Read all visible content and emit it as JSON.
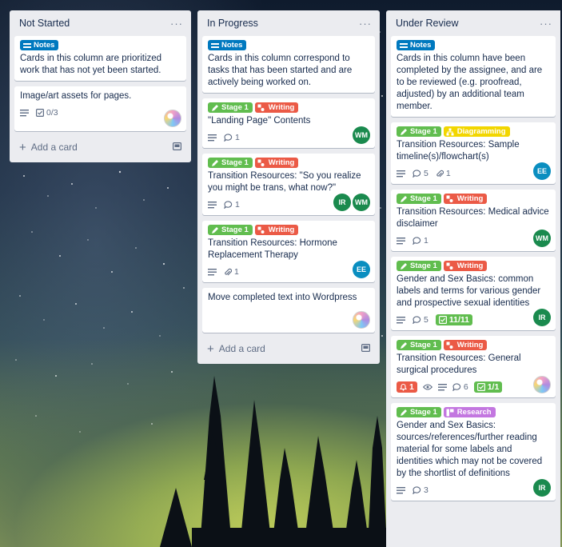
{
  "colors": {
    "notes": "#0079bf",
    "stage": "#61bd4f",
    "writing": "#eb5a46",
    "diagramming": "#f2d600",
    "research": "#c377e0",
    "avatar_wm": "#1a8a4e",
    "avatar_ir": "#1a8a4e",
    "avatar_ee": "#0a8ec0"
  },
  "columns": {
    "not_started": {
      "title": "Not Started",
      "menu": "···",
      "add_card": "Add a card",
      "cards": {
        "notes": {
          "label": "Notes",
          "title": "Cards in this column are prioritized work that has not yet been started."
        },
        "assets": {
          "title": "Image/art assets for pages.",
          "checklist": "0/3"
        }
      }
    },
    "in_progress": {
      "title": "In Progress",
      "menu": "···",
      "add_card": "Add a card",
      "cards": {
        "notes": {
          "label": "Notes",
          "title": "Cards in this column correspond to tasks that has been started and are actively being worked on."
        },
        "landing": {
          "label_stage": "Stage 1",
          "label_type": "Writing",
          "title": "\"Landing Page\" Contents",
          "comments": "1",
          "member1": "WM"
        },
        "trans": {
          "label_stage": "Stage 1",
          "label_type": "Writing",
          "title": "Transition Resources: \"So you realize you might be trans, what now?\"",
          "comments": "1",
          "member1": "IR",
          "member2": "WM"
        },
        "hrt": {
          "label_stage": "Stage 1",
          "label_type": "Writing",
          "title": "Transition Resources: Hormone Replacement Therapy",
          "attachments": "1",
          "member1": "EE"
        },
        "wordpress": {
          "title": "Move completed text into Wordpress"
        }
      }
    },
    "under_review": {
      "title": "Under Review",
      "menu": "···",
      "cards": {
        "notes": {
          "label": "Notes",
          "title": "Cards in this column have been completed by the assignee, and are to be reviewed (e.g. proofread, adjusted) by an additional team member."
        },
        "timeline": {
          "label_stage": "Stage 1",
          "label_type": "Diagramming",
          "title": "Transition Resources: Sample timeline(s)/flowchart(s)",
          "comments": "5",
          "attachments": "1",
          "member1": "EE"
        },
        "medical": {
          "label_stage": "Stage 1",
          "label_type": "Writing",
          "title": "Transition Resources: Medical advice disclaimer",
          "comments": "1",
          "member1": "WM"
        },
        "basics": {
          "label_stage": "Stage 1",
          "label_type": "Writing",
          "title": "Gender and Sex Basics: common labels and terms for various gender and prospective sexual identities",
          "comments": "5",
          "checklist": "11/11",
          "member1": "IR"
        },
        "surgical": {
          "label_stage": "Stage 1",
          "label_type": "Writing",
          "title": "Transition Resources: General surgical procedures",
          "notifications": "1",
          "comments": "6",
          "checklist": "1/1"
        },
        "sources": {
          "label_stage": "Stage 1",
          "label_type": "Research",
          "title": "Gender and Sex Basics: sources/references/further reading material for some labels and identities which may not be covered by the shortlist of definitions",
          "comments": "3",
          "member1": "IR"
        }
      }
    }
  }
}
